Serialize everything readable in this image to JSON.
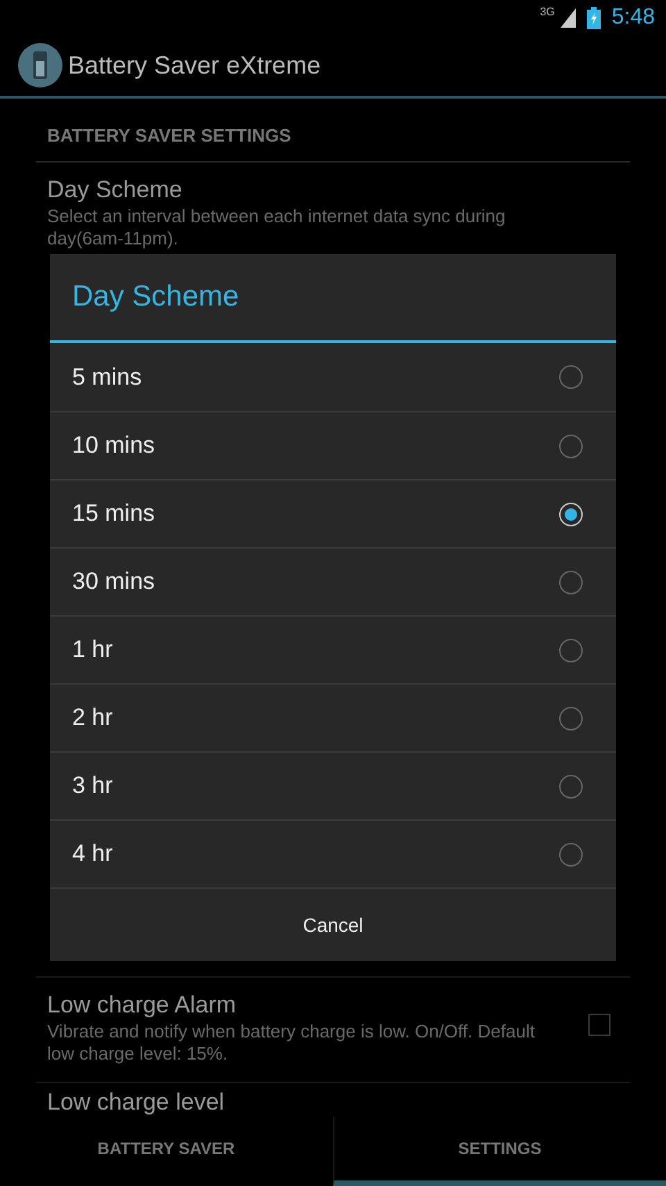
{
  "status_bar": {
    "network": "3G",
    "time": "5:48"
  },
  "app_bar": {
    "title": "Battery Saver eXtreme"
  },
  "settings": {
    "section": "BATTERY SAVER SETTINGS",
    "items": [
      {
        "kind": "text",
        "title": "Day Scheme",
        "summary": "Select an interval between each internet data sync during day(6am-11pm)."
      },
      {
        "kind": "checkbox",
        "title": "Low charge Alarm",
        "summary": "Vibrate and notify when battery charge is low. On/Off. Default low charge level: 15%.",
        "checked": false
      },
      {
        "kind": "text",
        "title": "Low charge level"
      }
    ]
  },
  "dialog": {
    "title": "Day Scheme",
    "options": [
      {
        "label": "5 mins",
        "selected": false
      },
      {
        "label": "10 mins",
        "selected": false
      },
      {
        "label": "15 mins",
        "selected": true
      },
      {
        "label": "30 mins",
        "selected": false
      },
      {
        "label": "1 hr",
        "selected": false
      },
      {
        "label": "2 hr",
        "selected": false
      },
      {
        "label": "3 hr",
        "selected": false
      },
      {
        "label": "4 hr",
        "selected": false
      }
    ],
    "button": "Cancel"
  },
  "tabs": [
    {
      "label": "BATTERY SAVER",
      "selected": false
    },
    {
      "label": "SETTINGS",
      "selected": true
    }
  ]
}
